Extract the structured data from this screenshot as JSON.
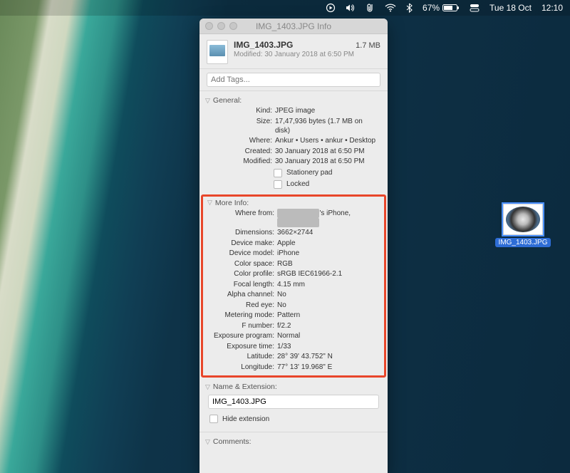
{
  "menubar": {
    "battery_pct": "67%",
    "date": "Tue 18 Oct",
    "time": "12:10"
  },
  "desktop_file": {
    "name": "IMG_1403.JPG"
  },
  "window": {
    "title": "IMG_1403.JPG Info",
    "header": {
      "filename": "IMG_1403.JPG",
      "size": "1.7 MB",
      "modified": "Modified: 30 January 2018 at 6:50 PM"
    },
    "tags_placeholder": "Add Tags...",
    "general": {
      "heading": "General:",
      "kind_label": "Kind:",
      "kind": "JPEG image",
      "size_label": "Size:",
      "size": "17,47,936 bytes (1.7 MB on disk)",
      "where_label": "Where:",
      "where": "Ankur • Users • ankur • Desktop",
      "created_label": "Created:",
      "created": "30 January 2018 at 6:50 PM",
      "modified_label": "Modified:",
      "modified": "30 January 2018 at 6:50 PM",
      "stationery": "Stationery pad",
      "locked": "Locked"
    },
    "more": {
      "heading": "More Info:",
      "wherefrom_label": "Where from:",
      "wherefrom_suffix": "'s iPhone,",
      "dimensions_label": "Dimensions:",
      "dimensions": "3662×2744",
      "devicemake_label": "Device make:",
      "devicemake": "Apple",
      "devicemodel_label": "Device model:",
      "devicemodel": "iPhone",
      "colorspace_label": "Color space:",
      "colorspace": "RGB",
      "colorprofile_label": "Color profile:",
      "colorprofile": "sRGB IEC61966-2.1",
      "focallength_label": "Focal length:",
      "focallength": "4.15 mm",
      "alpha_label": "Alpha channel:",
      "alpha": "No",
      "redeye_label": "Red eye:",
      "redeye": "No",
      "metering_label": "Metering mode:",
      "metering": "Pattern",
      "fnumber_label": "F number:",
      "fnumber": "f/2.2",
      "exposureprog_label": "Exposure program:",
      "exposureprog": "Normal",
      "exposuretime_label": "Exposure time:",
      "exposuretime": "1/33",
      "latitude_label": "Latitude:",
      "latitude": "28° 39' 43.752\" N",
      "longitude_label": "Longitude:",
      "longitude": "77° 13' 19.968\" E"
    },
    "nameext": {
      "heading": "Name & Extension:",
      "value": "IMG_1403.JPG",
      "hide": "Hide extension"
    },
    "comments": {
      "heading": "Comments:"
    }
  }
}
